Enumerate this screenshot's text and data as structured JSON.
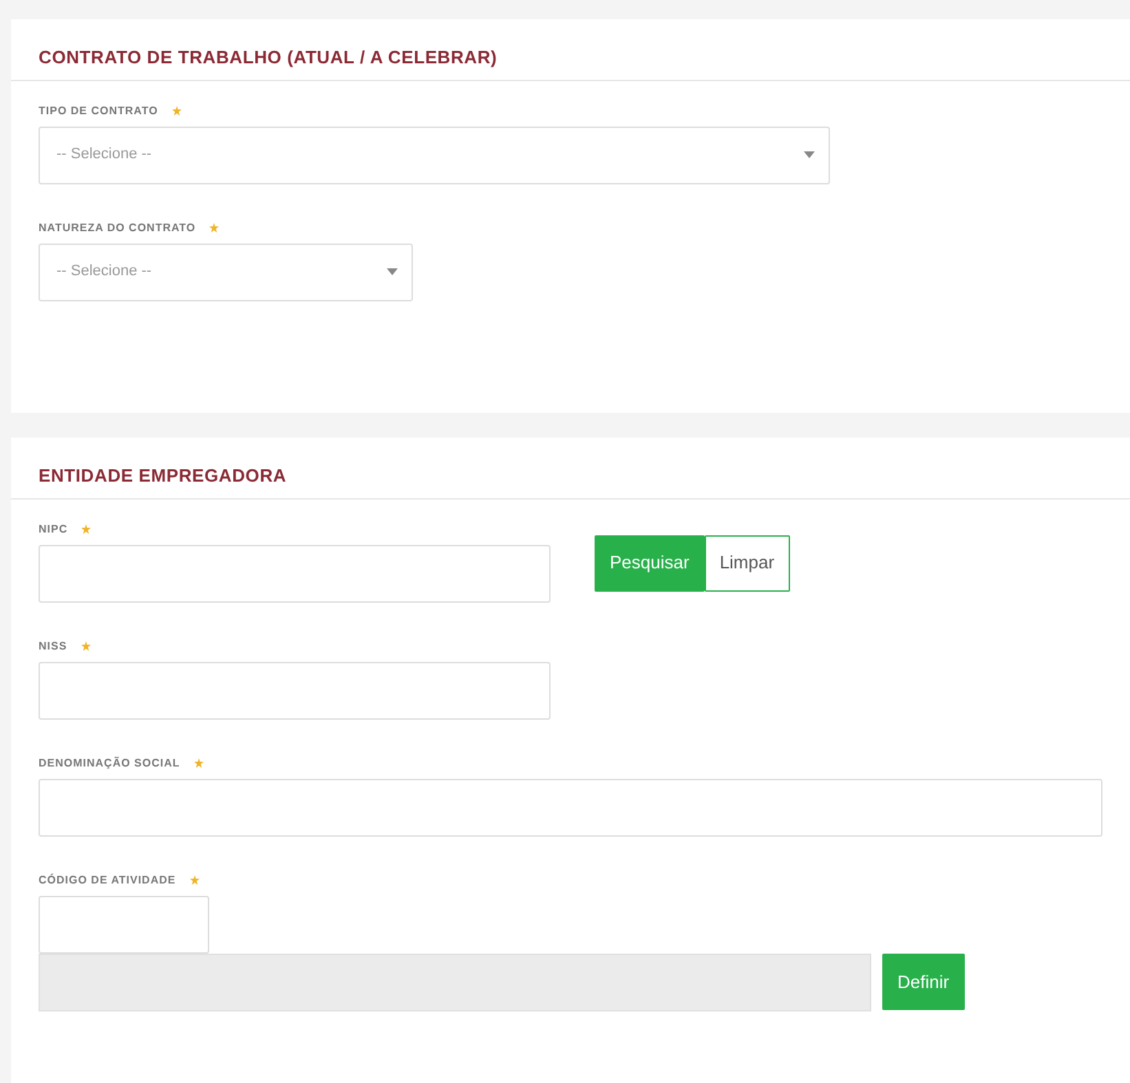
{
  "sections": [
    {
      "title": "CONTRATO DE TRABALHO (ATUAL / A CELEBRAR)",
      "fields": [
        {
          "kind": "select",
          "label": "TIPO DE CONTRATO",
          "required": true,
          "placeholder": "-- Selecione --"
        },
        {
          "kind": "select",
          "label": "NATUREZA DO CONTRATO",
          "required": true,
          "placeholder": "-- Selecione --"
        }
      ]
    },
    {
      "title": "ENTIDADE EMPREGADORA",
      "fields": [
        {
          "kind": "text",
          "label": "NIPC",
          "required": true,
          "buttons": [
            {
              "label": "Pesquisar",
              "kind": "primary"
            },
            {
              "label": "Limpar",
              "kind": "outline"
            }
          ]
        },
        {
          "kind": "text",
          "label": "NISS",
          "required": true
        },
        {
          "kind": "text",
          "label": "DENOMINAÇÃO SOCIAL",
          "required": true
        },
        {
          "kind": "text",
          "label": "CÓDIGO DE ATIVIDADE",
          "required": true,
          "disabled_field": true,
          "buttons": [
            {
              "label": "Definir",
              "kind": "primary"
            }
          ]
        }
      ]
    }
  ]
}
